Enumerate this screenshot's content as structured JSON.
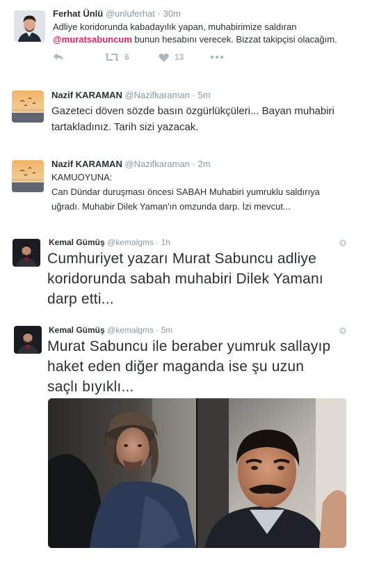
{
  "tweets": [
    {
      "name": "Ferhat Ünlü",
      "handle": "@unluferhat",
      "sep": "·",
      "time": "30m",
      "text_line1": "Adliye koridorunda kabadayılık yapan, muhabirimize saldıran",
      "mention": "@muratsabuncum",
      "text_line2_rest": " bunun hesabını verecek. Bizzat takipçisi olacağım.",
      "retweet_count": "6",
      "like_count": "13",
      "icons": [
        "reply-icon",
        "retweet-icon",
        "like-icon",
        "more-icon"
      ]
    },
    {
      "name": "Nazif KARAMAN",
      "handle": "@Nazifkaraman",
      "sep": "·",
      "time": "5m",
      "lines": [
        "Gazeteci döven sözde basın özgürlükçüleri... Bayan muhabiri",
        "tartakladınız. Tarih sizi yazacak."
      ]
    },
    {
      "name": "Nazif KARAMAN",
      "handle": "@Nazifkaraman",
      "sep": "·",
      "time": "2m",
      "lines": [
        "KAMUOYUNA:",
        "Can Dündar duruşması öncesi SABAH Muhabiri yumruklu saldırıya",
        "uğradı. Muhabir Dilek Yaman'ın omzunda darp. İzi mevcut..."
      ]
    },
    {
      "name": "Kemal Gümüş",
      "handle": "@kemalgms",
      "sep": "·",
      "time": "1h",
      "lines": [
        "Cumhuriyet yazarı Murat Sabuncu adliye",
        "koridorunda sabah muhabiri Dilek Yamanı",
        "darp etti..."
      ]
    },
    {
      "name": "Kemal Gümüş",
      "handle": "@kemalgms",
      "sep": "·",
      "time": "5m",
      "lines": [
        "Murat Sabuncu ile beraber yumruk sallayıp",
        "haket eden diğer maganda ise şu uzun",
        "saçlı bıyıklı..."
      ]
    }
  ],
  "colors": {
    "text": "#292f33",
    "meta": "#8899a6",
    "mention": "#e0245e",
    "action": "#aab8c2"
  }
}
